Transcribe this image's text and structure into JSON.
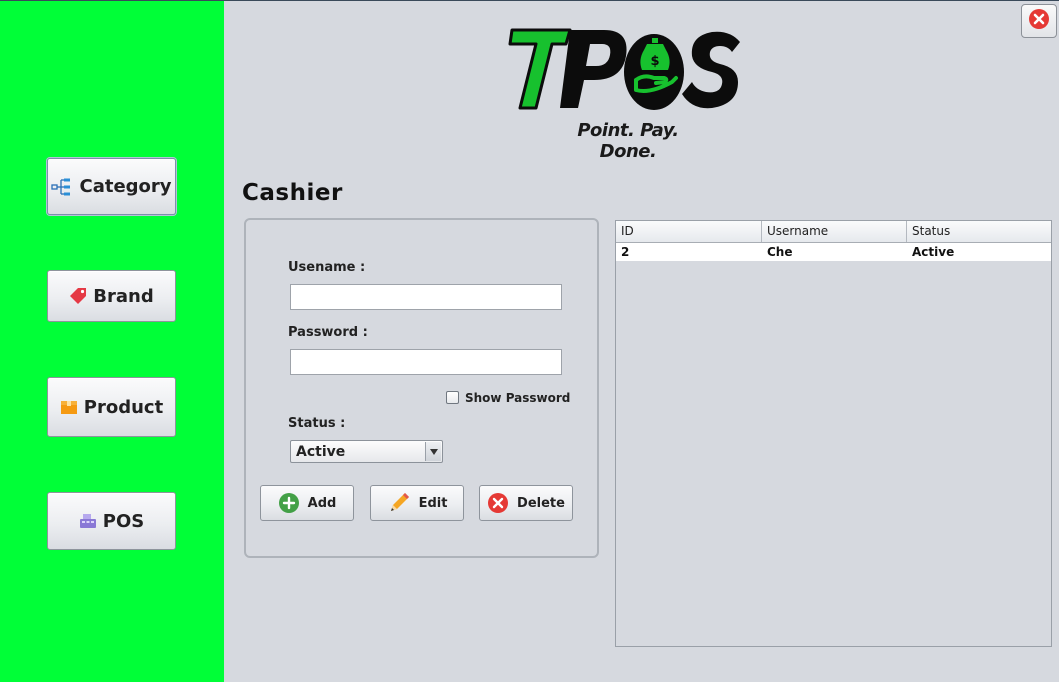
{
  "sidebar": {
    "items": [
      {
        "label": "Category",
        "icon": "category-icon"
      },
      {
        "label": "Brand",
        "icon": "tag-icon"
      },
      {
        "label": "Product",
        "icon": "box-icon"
      },
      {
        "label": "POS",
        "icon": "register-icon"
      }
    ],
    "bg_color": "#00ff37"
  },
  "header": {
    "logo_text": "TPOS",
    "tagline": "Point. Pay. Done."
  },
  "page_title": "Cashier",
  "form": {
    "username_label": "Usename :",
    "username_value": "",
    "password_label": "Password :",
    "password_value": "",
    "show_password_label": "Show Password",
    "show_password_checked": false,
    "status_label": "Status :",
    "status_value": "Active"
  },
  "actions": {
    "add_label": "Add",
    "edit_label": "Edit",
    "delete_label": "Delete"
  },
  "table": {
    "columns": [
      "ID",
      "Username",
      "Status"
    ],
    "rows": [
      [
        "2",
        "Che",
        "Active"
      ]
    ]
  },
  "colors": {
    "accent_green": "#00ff37",
    "logo_green": "#17c12e",
    "delete_red": "#e53935",
    "add_green": "#43a047"
  }
}
